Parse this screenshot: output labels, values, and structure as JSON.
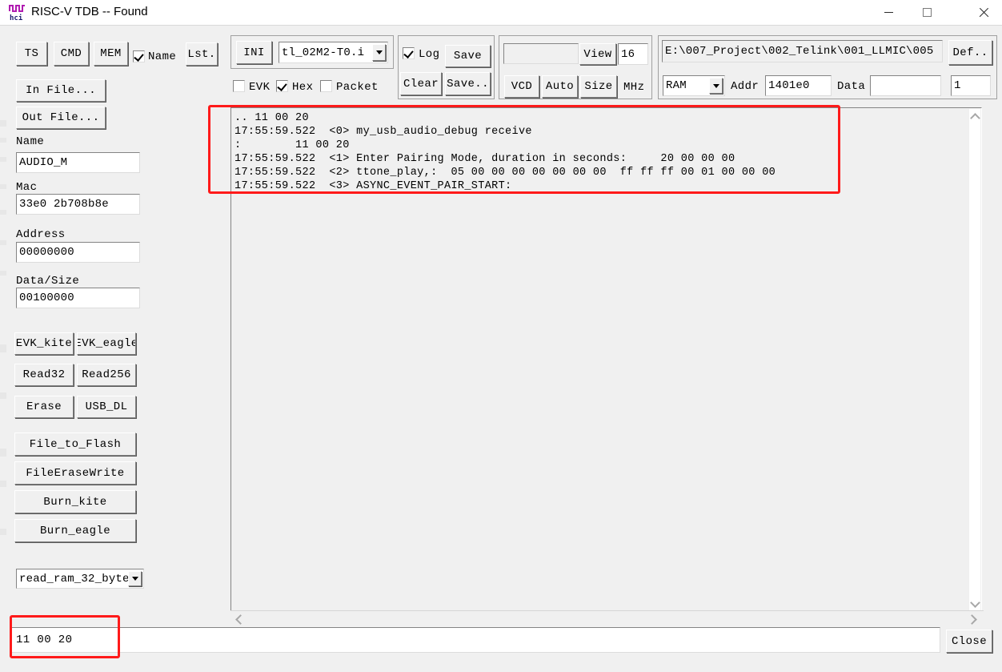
{
  "window": {
    "title": "RISC-V TDB -- Found",
    "icon_name": "hci-waveform-icon",
    "minimize_label": "",
    "maximize_label": "",
    "close_label": ""
  },
  "toolbar": {
    "ts_label": "TS",
    "cmd_label": "CMD",
    "mem_label": "MEM",
    "name_checkbox_label": "Name",
    "name_checked": true,
    "lst_label": "Lst.",
    "in_file_label": "In File...",
    "out_file_label": "Out File..."
  },
  "ini_group": {
    "ini_label": "INI",
    "file_combo_value": "tl_02M2-T0.i",
    "evk_label": "EVK",
    "evk_checked": false,
    "hex_label": "Hex",
    "hex_checked": true,
    "packet_label": "Packet",
    "packet_checked": false
  },
  "log_group": {
    "log_label": "Log",
    "log_checked": true,
    "save_label": "Save",
    "clear_label": "Clear",
    "saveas_label": "Save.."
  },
  "vcd_group": {
    "freq_value": "",
    "view_label": "View",
    "size_value": "16",
    "vcd_label": "VCD",
    "auto_label": "Auto",
    "size_label": "Size",
    "mhz_label": "MHz"
  },
  "path_group": {
    "path_value": "E:\\007_Project\\002_Telink\\001_LLMIC\\005",
    "def_label": "Def..",
    "mem_type_value": "RAM",
    "addr_label": "Addr",
    "addr_value": "1401e0",
    "data_label": "Data",
    "data_value": "",
    "count_value": "1"
  },
  "sidebar": {
    "name_label": "Name",
    "name_value": "AUDIO_M",
    "mac_label": "Mac",
    "mac_value": "33e0 2b708b8e",
    "address_label": "Address",
    "address_value": "00000000",
    "datasize_label": "Data/Size",
    "datasize_value": "00100000",
    "buttons": [
      "EVK_kite",
      "EVK_eagle",
      "Read32",
      "Read256",
      "Erase",
      "USB_DL",
      "File_to_Flash",
      "FileEraseWrite",
      "Burn_kite",
      "Burn_eagle"
    ],
    "script_combo_value": "read_ram_32_byte"
  },
  "log_output": {
    "lines": [
      ".. 11 00 20",
      "17:55:59.522  <0> my_usb_audio_debug receive",
      ":        11 00 20",
      "17:55:59.522  <1> Enter Pairing Mode, duration in seconds:     20 00 00 00",
      "17:55:59.522  <2> ttone_play,:  05 00 00 00 00 00 00 00  ff ff ff 00 01 00 00 00",
      "17:55:59.522  <3> ASYNC_EVENT_PAIR_START:"
    ],
    "text": ".. 11 00 20\n17:55:59.522  <0> my_usb_audio_debug receive\n:        11 00 20\n17:55:59.522  <1> Enter Pairing Mode, duration in seconds:     20 00 00 00\n17:55:59.522  <2> ttone_play,:  05 00 00 00 00 00 00 00  ff ff ff 00 01 00 00 00\n17:55:59.522  <3> ASYNC_EVENT_PAIR_START:"
  },
  "bottom": {
    "command_value": "11 00 20",
    "close_label": "Close"
  },
  "colors": {
    "annotation_red": "#ff1a1a",
    "window_bg": "#f0f0f0",
    "field_bg": "#ffffff"
  }
}
